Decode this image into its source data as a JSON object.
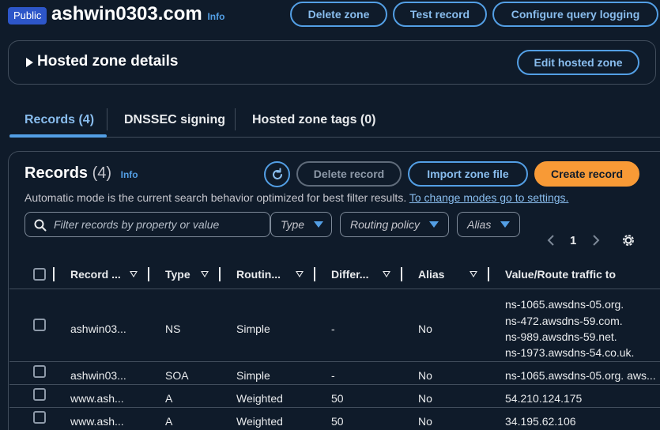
{
  "header": {
    "badge": "Public",
    "zone_name": "ashwin0303.com",
    "info": "Info",
    "buttons": {
      "delete_zone": "Delete zone",
      "test_record": "Test record",
      "configure_logging": "Configure query logging"
    }
  },
  "details_panel": {
    "title": "Hosted zone details",
    "edit_button": "Edit hosted zone"
  },
  "tabs": [
    {
      "label": "Records (4)",
      "active": true
    },
    {
      "label": "DNSSEC signing",
      "active": false
    },
    {
      "label": "Hosted zone tags (0)",
      "active": false
    }
  ],
  "records": {
    "title": "Records",
    "count": "(4)",
    "info": "Info",
    "buttons": {
      "delete": "Delete record",
      "import": "Import zone file",
      "create": "Create record"
    },
    "help_text": "Automatic mode is the current search behavior optimized for best filter results.",
    "help_link": "To change modes go to settings.",
    "search_placeholder": "Filter records by property or value",
    "filters": {
      "type": "Type",
      "routing": "Routing policy",
      "alias": "Alias"
    },
    "pagination": {
      "current_page": "1"
    },
    "columns": [
      "Record ...",
      "Type",
      "Routin...",
      "Differ...",
      "Alias",
      "Value/Route traffic to"
    ],
    "rows": [
      {
        "name": "ashwin03...",
        "type": "NS",
        "routing": "Simple",
        "differ": "-",
        "alias": "No",
        "value": [
          "ns-1065.awsdns-05.org.",
          "ns-472.awsdns-59.com.",
          "ns-989.awsdns-59.net.",
          "ns-1973.awsdns-54.co.uk."
        ]
      },
      {
        "name": "ashwin03...",
        "type": "SOA",
        "routing": "Simple",
        "differ": "-",
        "alias": "No",
        "value": [
          "ns-1065.awsdns-05.org. aws..."
        ]
      },
      {
        "name": "www.ash...",
        "type": "A",
        "routing": "Weighted",
        "differ": "50",
        "alias": "No",
        "value": [
          "54.210.124.175"
        ]
      },
      {
        "name": "www.ash...",
        "type": "A",
        "routing": "Weighted",
        "differ": "50",
        "alias": "No",
        "value": [
          "34.195.62.106"
        ]
      }
    ]
  },
  "colors": {
    "background": "#0f1b2a",
    "accent": "#539fe5",
    "primary_button": "#f89a36",
    "border": "#414d5c"
  }
}
